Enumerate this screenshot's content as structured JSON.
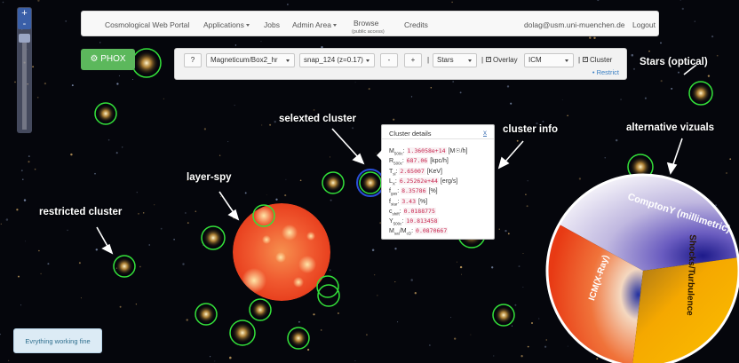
{
  "navbar": {
    "brand": "Cosmological Web Portal",
    "applications": "Applications",
    "jobs": "Jobs",
    "admin": "Admin Area",
    "browse": "Browse",
    "browse_sub": "(public access)",
    "credits": "Credits",
    "user_email": "dolag@usm.uni-muenchen.de",
    "logout": "Logout"
  },
  "phox_button": "PHOX",
  "toolbar": {
    "help": "?",
    "simulation": "Magneticum/Box2_hr",
    "snapshot": "snap_124 (z=0.17)",
    "minus": "-",
    "plus": "+",
    "sep1": "|",
    "layer": "Stars",
    "sep2": "|",
    "overlay_label": "Overlay",
    "overlay_value": "ICM",
    "sep3": "|",
    "cluster_label": "Cluster",
    "restrict": "Restrict"
  },
  "annotations": {
    "stars_optical": "Stars (optical)",
    "selected_cluster": "selexted cluster",
    "cluster_info": "cluster info",
    "alternative_vizuals": "alternative vizuals",
    "layer_spy": "layer-spy",
    "restricted_cluster": "restricted cluster"
  },
  "popup": {
    "title": "Cluster details",
    "close": "x",
    "rows": [
      {
        "sym": "M",
        "sub": "500c",
        "value": "1.36058e+14",
        "unit": "[M☉/h]"
      },
      {
        "sym": "R",
        "sub": "500c",
        "value": "687.06",
        "unit": "[kpc/h]"
      },
      {
        "sym": "T",
        "sub": "sl",
        "value": "2.65007",
        "unit": "[KeV]"
      },
      {
        "sym": "L",
        "sub": "X",
        "value": "6.25262e+44",
        "unit": "[erg/s]"
      },
      {
        "sym": "f",
        "sub": "gas",
        "value": "8.35786",
        "unit": "[%]"
      },
      {
        "sym": "f",
        "sub": "star",
        "value": "3.43",
        "unit": "[%]"
      },
      {
        "sym": "c",
        "sub": "shift",
        "value": "0.0188775",
        "unit": ""
      },
      {
        "sym": "Y",
        "sub": "500c",
        "value": "10.813458",
        "unit": ""
      },
      {
        "sym": "M",
        "sub": "sat",
        "sym2": "/M",
        "sub2": "cD",
        "value": "0.0870667",
        "unit": ""
      }
    ]
  },
  "wheel": {
    "comptony": "ComptonY (millimetric)",
    "icm": "ICM(X-Ray)",
    "shocks": "Shocks/Turbulence",
    "colors": {
      "red": "#f04418",
      "purple": "#7a5fb0",
      "orange": "#f7a400"
    }
  },
  "status": "Evrything working fine",
  "colors": {
    "sky": "#05060c",
    "circle": "#34e23a",
    "phox": "#5cb85c"
  }
}
